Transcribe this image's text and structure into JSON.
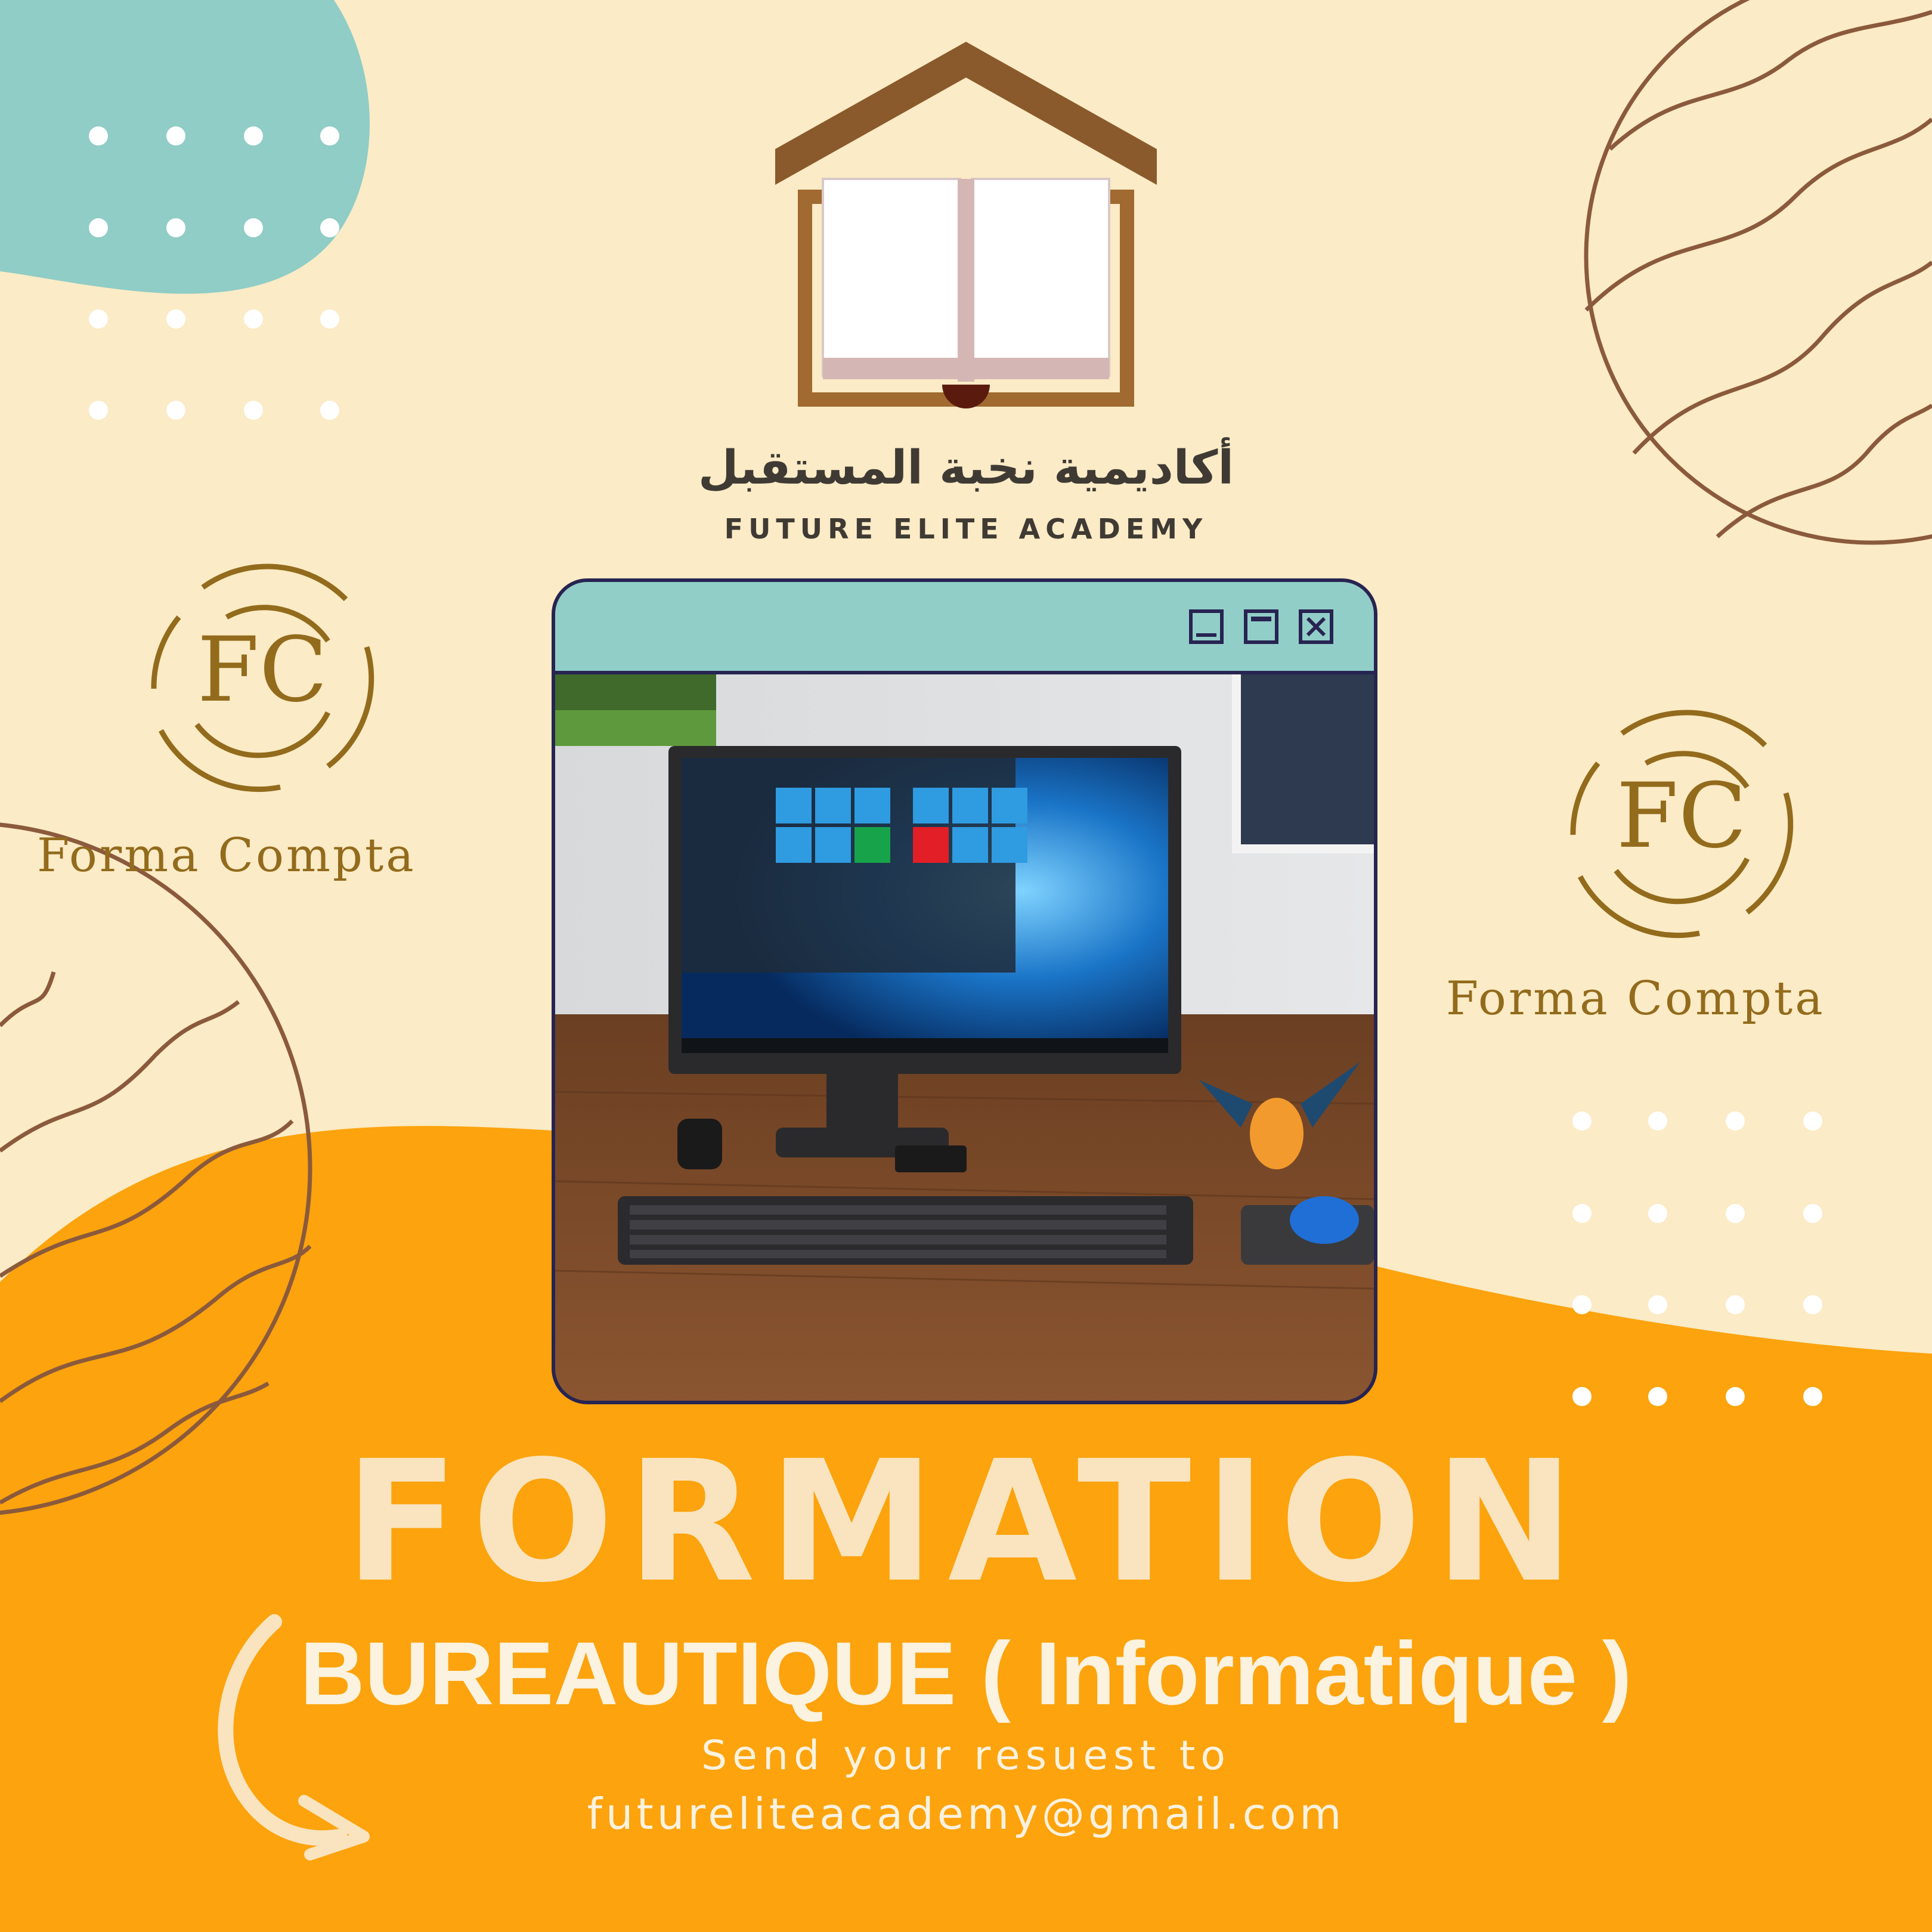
{
  "brand": {
    "arabic_name": "أكاديمية نخبة المستقبل",
    "english_name": "FUTURE ELITE ACADEMY"
  },
  "partner": {
    "monogram": "FC",
    "name": "Forma Compta"
  },
  "window": {
    "photo_icon": "desktop-computer-photo",
    "buttons": [
      "minimize-icon",
      "maximize-icon",
      "close-icon"
    ]
  },
  "headline": "FORMATION",
  "subtitle": "BUREAUTIQUE ( Informatique )",
  "cta": "Send your resuest to",
  "email": "futureliteacademy@gmail.com",
  "colors": {
    "background": "#fbebc6",
    "orange": "#fca30d",
    "teal": "#8fcdc6",
    "brown": "#8b5a3c",
    "gold": "#936b1c",
    "navy": "#272452"
  }
}
